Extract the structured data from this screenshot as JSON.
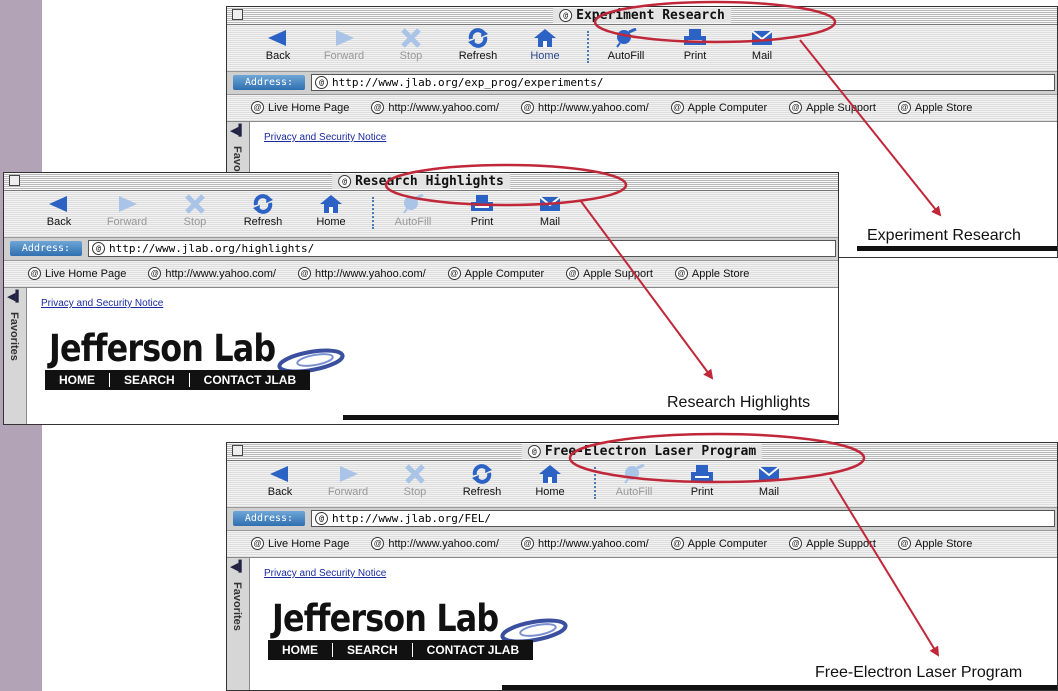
{
  "toolbar": {
    "back": "Back",
    "forward": "Forward",
    "stop": "Stop",
    "refresh": "Refresh",
    "home": "Home",
    "autofill": "AutoFill",
    "print": "Print",
    "mail": "Mail"
  },
  "address_label": "Address:",
  "favorites": [
    "Live Home Page",
    "http://www.yahoo.com/",
    "http://www.yahoo.com/",
    "Apple Computer",
    "Apple Support",
    "Apple Store"
  ],
  "sidebar_tab_label": "Favorites",
  "page": {
    "privacy_link": "Privacy and Security Notice",
    "logo_text": "Jefferson Lab",
    "nav": [
      "HOME",
      "SEARCH",
      "CONTACT JLAB"
    ]
  },
  "windows": [
    {
      "title": "Experiment Research",
      "url": "http://www.jlab.org/exp_prog/experiments/",
      "page_title": "Experiment Research"
    },
    {
      "title": "Research Highlights",
      "url": "http://www.jlab.org/highlights/",
      "page_title": "Research Highlights"
    },
    {
      "title": "Free-Electron Laser Program",
      "url": "http://www.jlab.org/FEL/",
      "page_title": "Free-Electron Laser Program"
    }
  ],
  "colors": {
    "left_band": "#b3a3b6",
    "annotation": "#c0283a",
    "address_label": "#2f6fb0",
    "link": "#1a2a9e"
  }
}
